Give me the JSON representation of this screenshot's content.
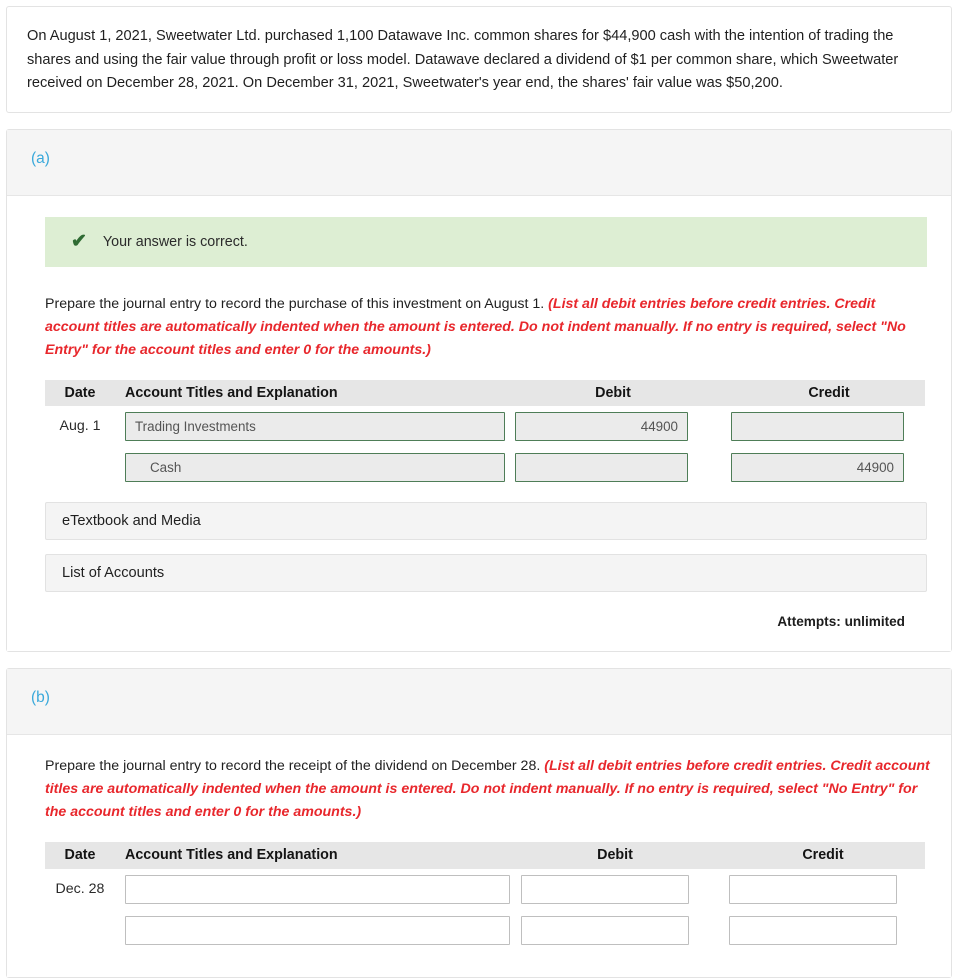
{
  "statement": {
    "text": "On August 1, 2021, Sweetwater Ltd. purchased 1,100 Datawave Inc. common shares for $44,900 cash with the intention of trading the shares and using the fair value through profit or loss model. Datawave declared a dividend of $1 per common share, which Sweetwater received on December 28, 2021. On December 31, 2021, Sweetwater's year end, the shares' fair value was $50,200."
  },
  "colors": {
    "accent_label": "#3aa9db",
    "hint_red": "#e8272c",
    "banner_bg": "#ddeed3",
    "check_green": "#2f6b33",
    "answered_border": "#4e7d57",
    "answered_bg": "#ebebeb",
    "table_header_bg": "#e6e6e6"
  },
  "table_headers": {
    "date": "Date",
    "account": "Account Titles and Explanation",
    "debit": "Debit",
    "credit": "Credit"
  },
  "instruction_hint": "(List all debit entries before credit entries. Credit account titles are automatically indented when the amount is entered. Do not indent manually. If no entry is required, select \"No Entry\" for the account titles and enter 0 for the amounts.)",
  "parts": [
    {
      "label": "(a)",
      "status": {
        "icon": "check-icon",
        "text": "Your answer is correct."
      },
      "prompt": "Prepare the journal entry to record the purchase of this investment on August 1.",
      "date_cell": "Aug. 1",
      "rows": [
        {
          "account": "Trading Investments",
          "indent": false,
          "debit": "44900",
          "credit": ""
        },
        {
          "account": "Cash",
          "indent": true,
          "debit": "",
          "credit": "44900"
        }
      ],
      "buttons": [
        {
          "name": "etextbook-and-media-button",
          "label": "eTextbook and Media"
        },
        {
          "name": "list-of-accounts-button",
          "label": "List of Accounts"
        }
      ],
      "attempts": "Attempts: unlimited"
    },
    {
      "label": "(b)",
      "prompt": "Prepare the journal entry to record the receipt of the dividend on December 28.",
      "date_cell": "Dec. 28",
      "rows": [
        {
          "account": "",
          "indent": false,
          "debit": "",
          "credit": ""
        },
        {
          "account": "",
          "indent": false,
          "debit": "",
          "credit": ""
        }
      ]
    }
  ]
}
